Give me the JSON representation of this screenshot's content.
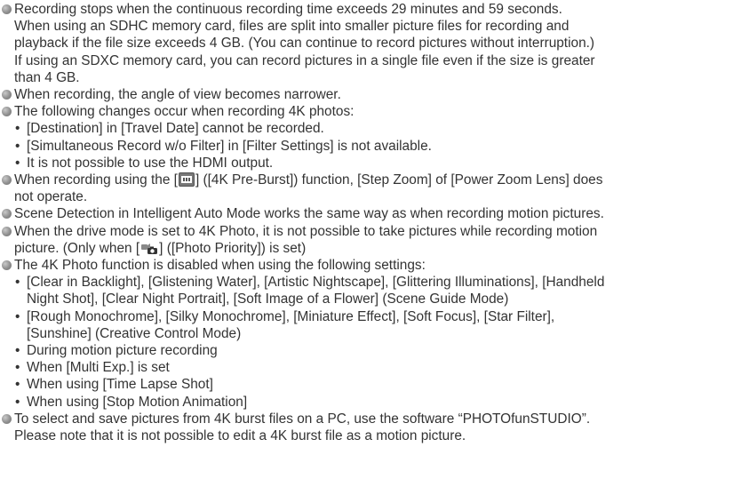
{
  "bullets": {
    "b1": {
      "line1": "Recording stops when the continuous recording time exceeds 29 minutes and 59 seconds.",
      "line2": "When using an SDHC memory card, files are split into smaller picture files for recording and",
      "line3": "playback if the file size exceeds 4 GB. (You can continue to record pictures without interruption.)",
      "line4": "If using an SDXC memory card, you can record pictures in a single file even if the size is greater",
      "line5": "than 4 GB."
    },
    "b2": "When recording, the angle of view becomes narrower.",
    "b3": {
      "intro": "The following changes occur when recording 4K photos:",
      "sub": [
        "[Destination] in [Travel Date] cannot be recorded.",
        "[Simultaneous Record w/o Filter] in [Filter Settings] is not available.",
        "It is not possible to use the HDMI output."
      ]
    },
    "b4": {
      "pre": "When recording using the [",
      "icon": "4k-pre-burst-icon",
      "post": "] ([4K Pre-Burst]) function, [Step Zoom] of [Power Zoom Lens] does",
      "line2": "not operate."
    },
    "b5": "Scene Detection in Intelligent Auto Mode works the same way as when recording motion pictures.",
    "b6": {
      "line1": "When the drive mode is set to 4K Photo, it is not possible to take pictures while recording motion",
      "pre": "picture. (Only when [",
      "icon": "photo-priority-icon",
      "post": "] ([Photo Priority]) is set)"
    },
    "b7": {
      "intro": "The 4K Photo function is disabled when using the following settings:",
      "s1a": "[Clear in Backlight], [Glistening Water], [Artistic Nightscape], [Glittering Illuminations], [Handheld",
      "s1b": "Night Shot], [Clear Night Portrait], [Soft Image of a Flower] (Scene Guide Mode)",
      "s2a": "[Rough Monochrome], [Silky Monochrome], [Miniature Effect], [Soft Focus], [Star Filter],",
      "s2b": "[Sunshine] (Creative Control Mode)",
      "s3": "During motion picture recording",
      "s4": "When [Multi Exp.] is set",
      "s5": "When using [Time Lapse Shot]",
      "s6": "When using [Stop Motion Animation]"
    },
    "b8": {
      "line1": "To select and save pictures from 4K burst files on a PC, use the software “PHOTOfunSTUDIO”.",
      "line2": "Please note that it is not possible to edit a 4K burst file as a motion picture."
    }
  },
  "sub_marker": "•",
  "colors": {
    "text": "#333333",
    "bullet": "#8f8f8f",
    "background": "#ffffff"
  }
}
